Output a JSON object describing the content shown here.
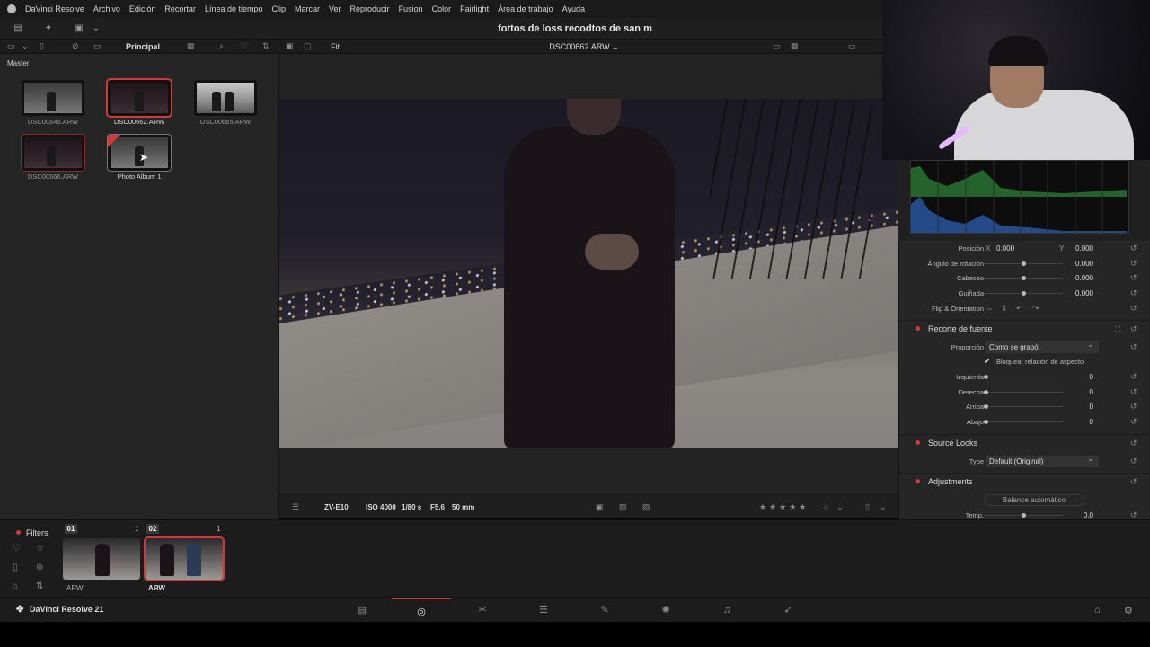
{
  "menubar": {
    "items": [
      "DaVinci Resolve",
      "Archivo",
      "Edición",
      "Recortar",
      "Línea de tiempo",
      "Clip",
      "Marcar",
      "Ver",
      "Reproducir",
      "Fusion",
      "Color",
      "Fairlight",
      "Área de trabajo",
      "Ayuda"
    ]
  },
  "project_title": "fottos de loss recodtos de san m",
  "subbar": {
    "bin_name": "Principal",
    "zoom": "Fit",
    "clip_name": "DSC00662.ARW ⌄"
  },
  "media_pool": {
    "master_label": "Master",
    "items": [
      {
        "name": "DSC00645.ARW"
      },
      {
        "name": "DSC00662.ARW"
      },
      {
        "name": "DSC00665.ARW"
      },
      {
        "name": "DSC00666.ARW"
      },
      {
        "name": "Photo Album 1"
      }
    ]
  },
  "viewer_info": {
    "camera": "ZV-E10",
    "iso": "ISO 4000",
    "shutter": "1/80 s",
    "aperture": "F5.6",
    "focal": "50 mm"
  },
  "inspector": {
    "transform": {
      "posicion_label": "Posición",
      "x_label": "X",
      "x_value": "0.000",
      "y_label": "Y",
      "y_value": "0.000",
      "rotation_label": "Ángulo de rotación",
      "rotation_value": "0.000",
      "pitch_label": "Cabeceo",
      "pitch_value": "0.000",
      "yaw_label": "Guiñada",
      "yaw_value": "0.000",
      "flip_label": "Flip & Orientation"
    },
    "crop": {
      "title": "Recorte de fuente",
      "proportion_label": "Proporción",
      "proportion_value": "Como se grabó",
      "lock_label": "Bloquear relación de aspecto",
      "left_label": "Izquierda",
      "left_value": "0",
      "right_label": "Derecha",
      "right_value": "0",
      "top_label": "Arriba",
      "top_value": "0",
      "bottom_label": "Abajo",
      "bottom_value": "0"
    },
    "source_looks": {
      "title": "Source Looks",
      "type_label": "Type",
      "type_value": "Default (Original)"
    },
    "adjustments": {
      "title": "Adjustments",
      "auto_balance": "Balance automático",
      "temp_label": "Temp.",
      "temp_value": "0.0"
    }
  },
  "timeline": {
    "filters_label": "Filters",
    "groups": [
      {
        "number": "01",
        "count": "1",
        "label": "ARW"
      },
      {
        "number": "02",
        "count": "1",
        "label": "ARW"
      }
    ]
  },
  "pagebar": {
    "brand": "DaVinci Resolve 21"
  },
  "colors": {
    "accent": "#d23a3a",
    "panel": "#252525"
  }
}
